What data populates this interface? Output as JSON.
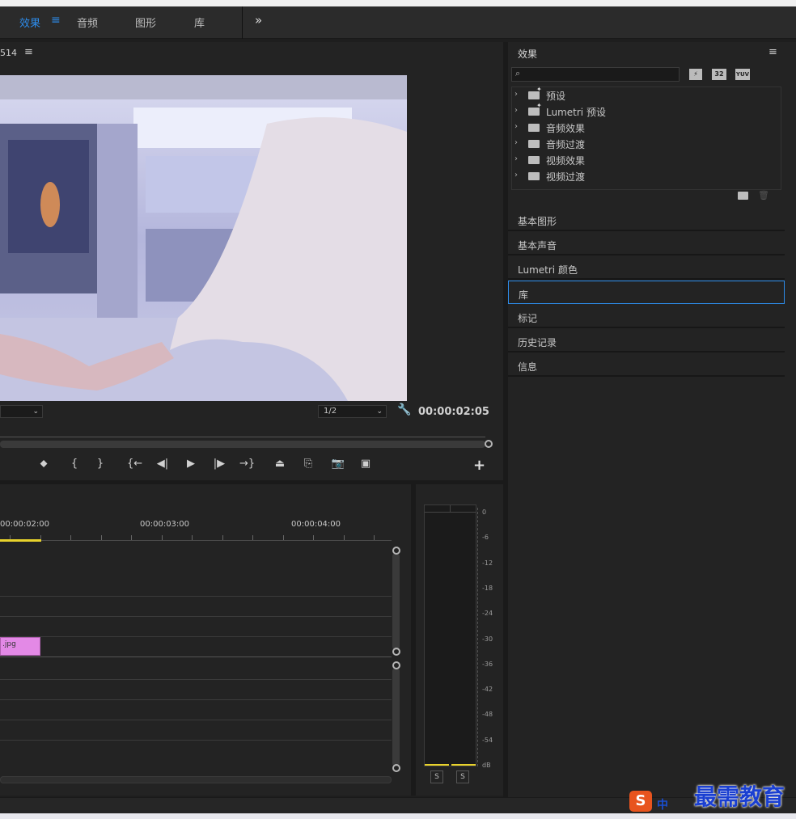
{
  "workspace_tabs": [
    "效果",
    "音频",
    "图形",
    "库"
  ],
  "workspace_menu_icon": "hamburger-icon",
  "workspace_more": "»",
  "program_monitor": {
    "title_fragment": "514",
    "menu_icon": "≡",
    "zoom_value": "",
    "resolution": "1/2",
    "timecode": "00:00:02:05"
  },
  "transport_buttons": [
    {
      "name": "add-marker-button",
      "glyph": "⬥"
    },
    {
      "name": "mark-in-button",
      "glyph": "{"
    },
    {
      "name": "mark-out-button",
      "glyph": "}"
    },
    {
      "name": "go-to-in-button",
      "glyph": "{←"
    },
    {
      "name": "step-back-button",
      "glyph": "◀|"
    },
    {
      "name": "play-button",
      "glyph": "▶"
    },
    {
      "name": "step-forward-button",
      "glyph": "|▶"
    },
    {
      "name": "go-to-out-button",
      "glyph": "→}"
    },
    {
      "name": "lift-button",
      "glyph": "⏏"
    },
    {
      "name": "extract-button",
      "glyph": "⎘"
    },
    {
      "name": "export-frame-button",
      "glyph": "📷"
    },
    {
      "name": "compare-view-button",
      "glyph": "▣"
    }
  ],
  "add_button": "+",
  "effects_panel": {
    "title": "效果",
    "menu": "≡",
    "search_placeholder": "",
    "filter_badges": [
      "32",
      "YUV"
    ],
    "tree": [
      {
        "label": "预设",
        "star": true
      },
      {
        "label": "Lumetri 预设",
        "star": true
      },
      {
        "label": "音频效果",
        "star": false
      },
      {
        "label": "音频过渡",
        "star": false
      },
      {
        "label": "视频效果",
        "star": false
      },
      {
        "label": "视频过渡",
        "star": false
      }
    ]
  },
  "accordion_panels": [
    "基本图形",
    "基本声音",
    "Lumetri 颜色",
    "库",
    "标记",
    "历史记录",
    "信息"
  ],
  "timeline": {
    "ruler_labels": [
      "00:00:02:00",
      "00:00:03:00",
      "00:00:04:00"
    ],
    "clip_label": ".jpg",
    "clip_color": "#e389e6"
  },
  "audio_meter": {
    "scale": [
      "0",
      "-6",
      "-12",
      "-18",
      "-24",
      "-30",
      "-36",
      "-42",
      "-48",
      "-54",
      "dB"
    ],
    "solo_buttons": [
      "S",
      "S"
    ]
  },
  "watermark": {
    "text": "最需教育",
    "ime": "中"
  },
  "colors": {
    "accent": "#2d8ceb",
    "playhead": "#e8d22c"
  }
}
